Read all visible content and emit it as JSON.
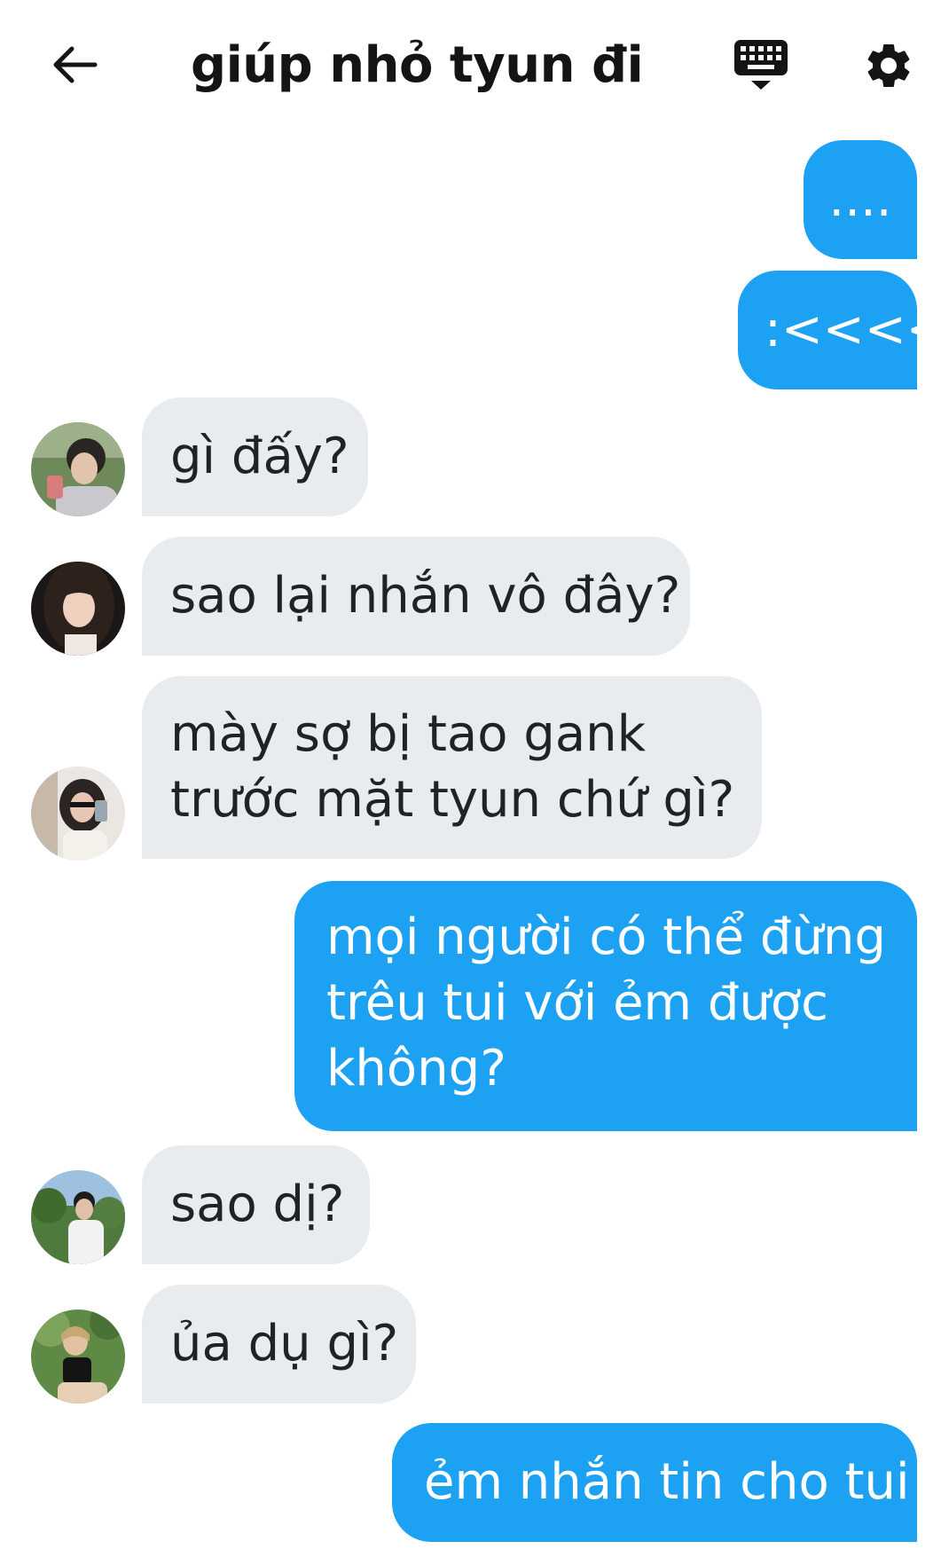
{
  "header": {
    "title": "giúp nhỏ tyun đi",
    "back_icon": "arrow-left-icon",
    "keyboard_icon": "keyboard-icon",
    "settings_icon": "gear-icon"
  },
  "colors": {
    "outgoing_bubble": "#1da1f2",
    "incoming_bubble": "#e9ecef",
    "text_dark": "#1f2328"
  },
  "messages": [
    {
      "direction": "outgoing",
      "lines": [
        "...."
      ]
    },
    {
      "direction": "outgoing",
      "lines": [
        ":<<<<"
      ]
    },
    {
      "direction": "incoming",
      "lines": [
        "gì đấy?"
      ]
    },
    {
      "direction": "incoming",
      "lines": [
        "sao lại nhắn vô đây?"
      ]
    },
    {
      "direction": "incoming",
      "lines": [
        "mày sợ bị tao gank",
        "trước mặt tyun chứ gì?"
      ]
    },
    {
      "direction": "outgoing",
      "lines": [
        "mọi người có thể đừng",
        "trêu tui với ẻm được",
        "không?"
      ]
    },
    {
      "direction": "incoming",
      "lines": [
        "sao dị?"
      ]
    },
    {
      "direction": "incoming",
      "lines": [
        "ủa dụ gì?"
      ]
    },
    {
      "direction": "outgoing",
      "lines": [
        "ẻm nhắn tin cho tui"
      ]
    }
  ]
}
